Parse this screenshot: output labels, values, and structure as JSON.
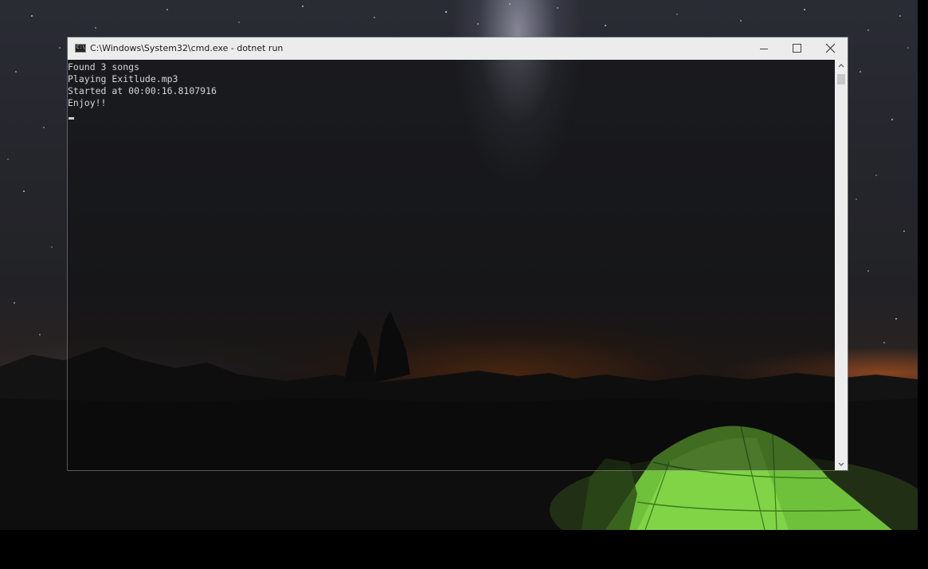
{
  "window": {
    "title": "C:\\Windows\\System32\\cmd.exe - dotnet  run",
    "icon": "cmd-console-icon",
    "controls": [
      "minimize-icon",
      "maximize-icon",
      "close-icon"
    ]
  },
  "console": {
    "lines": [
      "Found 3 songs",
      "Playing Exitlude.mp3",
      "Started at 00:00:16.8107916",
      "Enjoy!!"
    ],
    "text_color": "#d6d6d6",
    "cursor": "underscore"
  },
  "colors": {
    "titlebar": "#ececec",
    "tent_glow": "#7fd23a",
    "horizon_glow": "#b05a22"
  }
}
